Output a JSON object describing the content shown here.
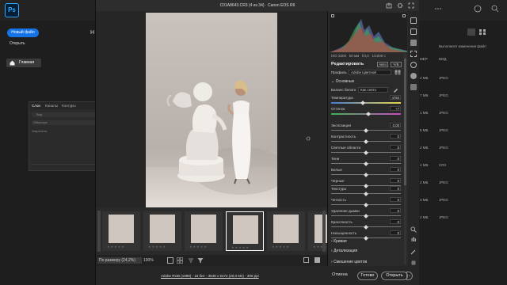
{
  "ps": {
    "logo": "Ps",
    "new_file": "Новый файл",
    "open": "Открыть",
    "home": "Главная",
    "partial_heading": "Н",
    "list_header_size": "МЕР",
    "list_header_type": "ВИД",
    "list_header_updated": "Выполните изменения файл",
    "file_rows": [
      {
        "size": "2 МБ",
        "type": "JPEG"
      },
      {
        "size": "7 МБ",
        "type": "JPEG"
      },
      {
        "size": "1 МБ",
        "type": "JPEG"
      },
      {
        "size": "5 МБ",
        "type": "JPEG"
      },
      {
        "size": "2 МБ",
        "type": "JPEG"
      },
      {
        "size": "1 МБ",
        "type": "CR3"
      },
      {
        "size": "2 МБ",
        "type": "JPEG"
      },
      {
        "size": "3 МБ",
        "type": "JPEG"
      },
      {
        "size": "2 МБ",
        "type": "JPEG"
      }
    ]
  },
  "layers_panel": {
    "tabs": [
      "Слои",
      "Каналы",
      "Контуры"
    ],
    "search_placeholder": "Вид",
    "mode": "Обычные",
    "lock_label": "Закрепить:"
  },
  "acr": {
    "title": "C01A8643.CR3 (4 из 34)  ·  Canon EOS R6",
    "zoom_label": "По размеру (24,2%)",
    "zoom_value": "100%",
    "file_info": "Adobe RGB (1998) - 16 бит - 3648 x 5472 (20,0 Мп) - 300 ppi",
    "cancel": "Отмена",
    "done": "Готово",
    "open": "Открыть",
    "thumbnails": 6,
    "selected_thumbnail": 4
  },
  "camera_info": {
    "iso": "ISO 3200",
    "lens": "50 мм",
    "aperture": "f/4,0",
    "shutter": "1/1000 с"
  },
  "edit_panel": {
    "title": "Редактировать",
    "auto": "Авто",
    "bw": "Ч/Б",
    "profile_label": "Профиль",
    "profile_value": "Adobe Цветной",
    "basic_section": "Основные",
    "wb_label": "Баланс белого",
    "wb_value": "Как снято",
    "sliders_top": [
      {
        "label": "Температура",
        "value": "4750",
        "pos": 0.45
      },
      {
        "label": "Оттенок",
        "value": "+7",
        "pos": 0.53
      }
    ],
    "sliders_mid": [
      {
        "label": "Экспозиция",
        "value": "0,00",
        "pos": 0.5
      },
      {
        "label": "Контрастность",
        "value": "0",
        "pos": 0.5
      },
      {
        "label": "Светлые области",
        "value": "0",
        "pos": 0.5
      },
      {
        "label": "Тени",
        "value": "0",
        "pos": 0.5
      },
      {
        "label": "Белые",
        "value": "0",
        "pos": 0.5
      },
      {
        "label": "Черные",
        "value": "0",
        "pos": 0.5
      }
    ],
    "sliders_pres": [
      {
        "label": "Текстура",
        "value": "0",
        "pos": 0.5
      },
      {
        "label": "Четкость",
        "value": "0",
        "pos": 0.5
      },
      {
        "label": "Удаление дымки",
        "value": "0",
        "pos": 0.5
      }
    ],
    "sliders_color": [
      {
        "label": "Красочность",
        "value": "0",
        "pos": 0.5
      },
      {
        "label": "Насыщенность",
        "value": "0",
        "pos": 0.5
      }
    ],
    "sections": [
      "Кривая",
      "Детализация",
      "Смешение цветов"
    ]
  },
  "colors": {
    "accent": "#1473e6",
    "ps_blue": "#31a8ff"
  }
}
